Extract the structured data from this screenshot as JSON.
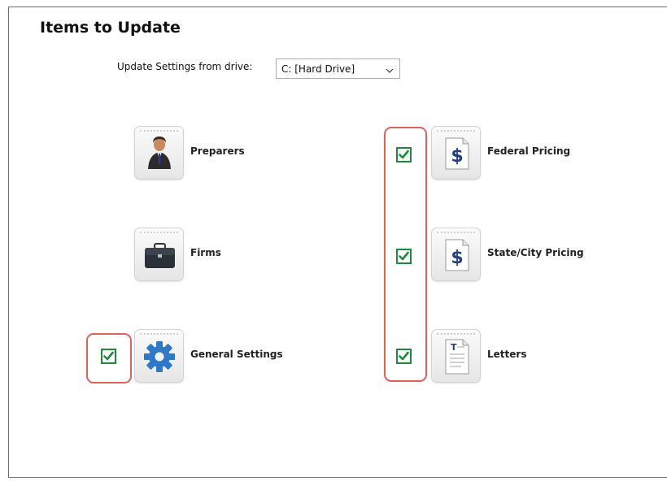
{
  "header": {
    "title": "Items to Update"
  },
  "drive": {
    "label": "Update Settings from drive:",
    "selected": "C: [Hard Drive]"
  },
  "items": {
    "preparers": {
      "label": "Preparers",
      "icon": "person-icon"
    },
    "firms": {
      "label": "Firms",
      "icon": "briefcase-icon"
    },
    "general_settings": {
      "label": "General Settings",
      "icon": "gear-icon",
      "checked": true
    },
    "federal_pricing": {
      "label": "Federal Pricing",
      "icon": "dollar-document-icon",
      "checked": true
    },
    "state_city_pricing": {
      "label": "State/City Pricing",
      "icon": "dollar-document-icon",
      "checked": true
    },
    "letters": {
      "label": "Letters",
      "icon": "text-document-icon",
      "checked": true
    }
  },
  "colors": {
    "check_green": "#1f8a3a",
    "highlight_red": "#e06060",
    "dollar_blue": "#1f3f8a",
    "gear_blue": "#2e78c8"
  }
}
